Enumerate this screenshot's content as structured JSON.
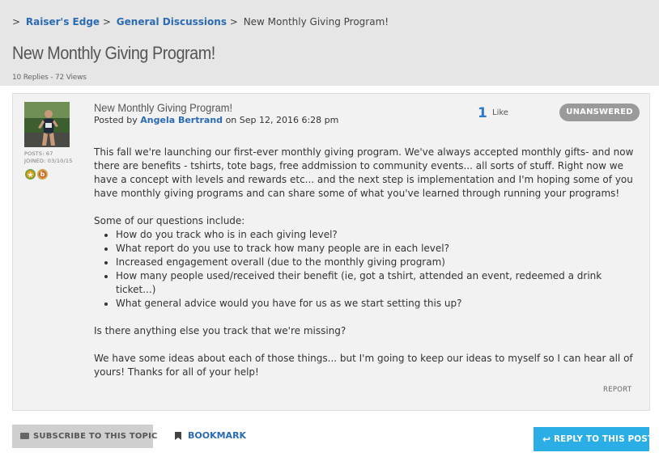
{
  "breadcrumb": {
    "separator": ">",
    "items": [
      {
        "label": "Raiser's Edge"
      },
      {
        "label": "General Discussions"
      }
    ],
    "current": "New Monthly Giving Program!"
  },
  "thread": {
    "title": "New Monthly Giving Program!",
    "meta": "10 Replies - 72 Views"
  },
  "post": {
    "title": "New Monthly Giving Program!",
    "posted_by_prefix": "Posted by",
    "author": "Angela Bertrand",
    "date": "on Sep 12, 2016 6:28 pm",
    "likes": "1",
    "like_label": "Like",
    "status": "UNANSWERED",
    "user": {
      "posts": "POSTS: 67",
      "joined": "JOINED: 03/10/15",
      "badge_icons": [
        "star-badge-icon",
        "b-badge-icon"
      ],
      "badge_b_letter": "b"
    },
    "body": {
      "intro": "This fall we're launching our first-ever monthly giving program. We've always accepted monthly gifts- and now there are benefits - tshirts, tote bags, free addmission to community events... all sorts of stuff. Right now we have a concept with levels and rewards etc... and the next step is implementation and I'm hoping some of you have monthly giving programs and can share some of what you've learned through running your programs!",
      "questions_intro": "Some of our questions include:",
      "questions": [
        "How do you track who is in each giving level?",
        "What report do you use to track how many people are in each level?",
        "Increased engagement overall (due to the monthly giving program)",
        "How many people used/received their benefit (ie, got a tshirt, attended an event, redeemed a drink ticket...)",
        "What general advice would you have for us as we start setting this up?"
      ],
      "question_extra": "Is there anything else you track that we're missing?",
      "closing": "We have some ideas about each of those things... but I'm going to keep our ideas to myself so I can hear all of yours! Thanks for all of your help!"
    },
    "report_label": "REPORT"
  },
  "actions": {
    "subscribe": "SUBSCRIBE TO THIS TOPIC",
    "bookmark": "BOOKMARK",
    "reply": "REPLY TO THIS POST"
  },
  "colors": {
    "link": "#2a6bb4",
    "accent": "#2aaee5",
    "status_badge": "#9a9a9a",
    "header_bg": "#e6e6e6"
  }
}
